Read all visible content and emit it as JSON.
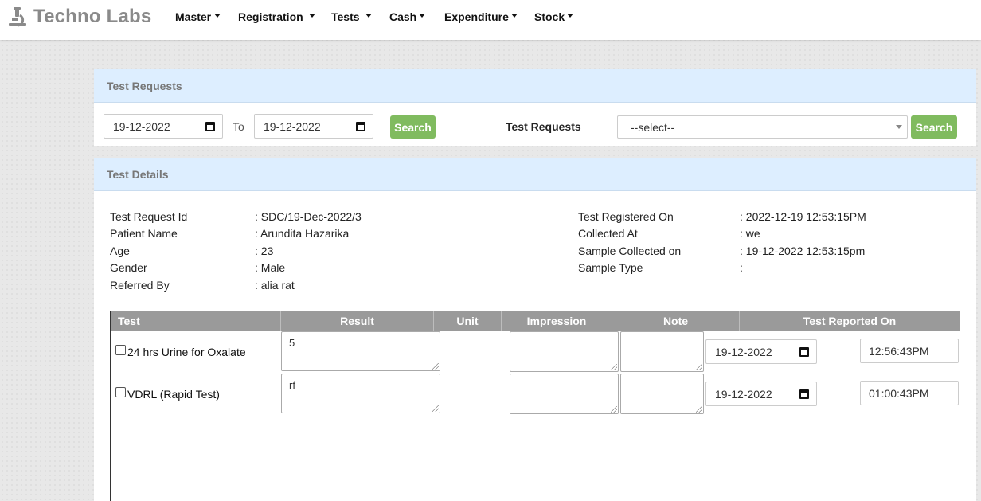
{
  "brand": {
    "name": "Techno Labs",
    "icon": "microscope-icon"
  },
  "nav": [
    "Master",
    "Registration",
    "Tests",
    "Cash",
    "Expenditure",
    "Stock"
  ],
  "requests_card": {
    "title": "Test Requests",
    "from_date": "19-12-2022",
    "to_label": "To",
    "to_date": "19-12-2022",
    "search_label": "Search",
    "select_label": "Test Requests",
    "select_value": "--select--",
    "search2_label": "Search"
  },
  "details_card": {
    "title": "Test Details",
    "left": [
      {
        "label": "Test Request Id",
        "value": ": SDC/19-Dec-2022/3"
      },
      {
        "label": "Patient Name",
        "value": ": Arundita Hazarika"
      },
      {
        "label": "Age",
        "value": ": 23"
      },
      {
        "label": "Gender",
        "value": ": Male"
      },
      {
        "label": "Referred By",
        "value": ": alia rat"
      }
    ],
    "right": [
      {
        "label": "Test Registered On",
        "value": ": 2022-12-19 12:53:15PM"
      },
      {
        "label": "Collected At",
        "value": ": we"
      },
      {
        "label": "Sample Collected on",
        "value": ": 19-12-2022 12:53:15pm"
      },
      {
        "label": "Sample Type",
        "value": ":"
      }
    ]
  },
  "table": {
    "headers": [
      "Test",
      "Result",
      "Unit",
      "Impression",
      "Note",
      "Test Reported On"
    ],
    "rows": [
      {
        "test": "24 hrs Urine for Oxalate",
        "checked": false,
        "result": "5",
        "unit": "",
        "impression": "",
        "note": "",
        "date": "19-12-2022",
        "time": "12:56:43PM"
      },
      {
        "test": "VDRL (Rapid Test)",
        "checked": false,
        "result": "rf",
        "unit": "",
        "impression": "",
        "note": "",
        "date": "19-12-2022",
        "time": "01:00:43PM"
      }
    ]
  },
  "colors": {
    "header_bg": "#ddeeff",
    "button_green": "#80bb5f",
    "table_head": "#9a9a9a"
  }
}
